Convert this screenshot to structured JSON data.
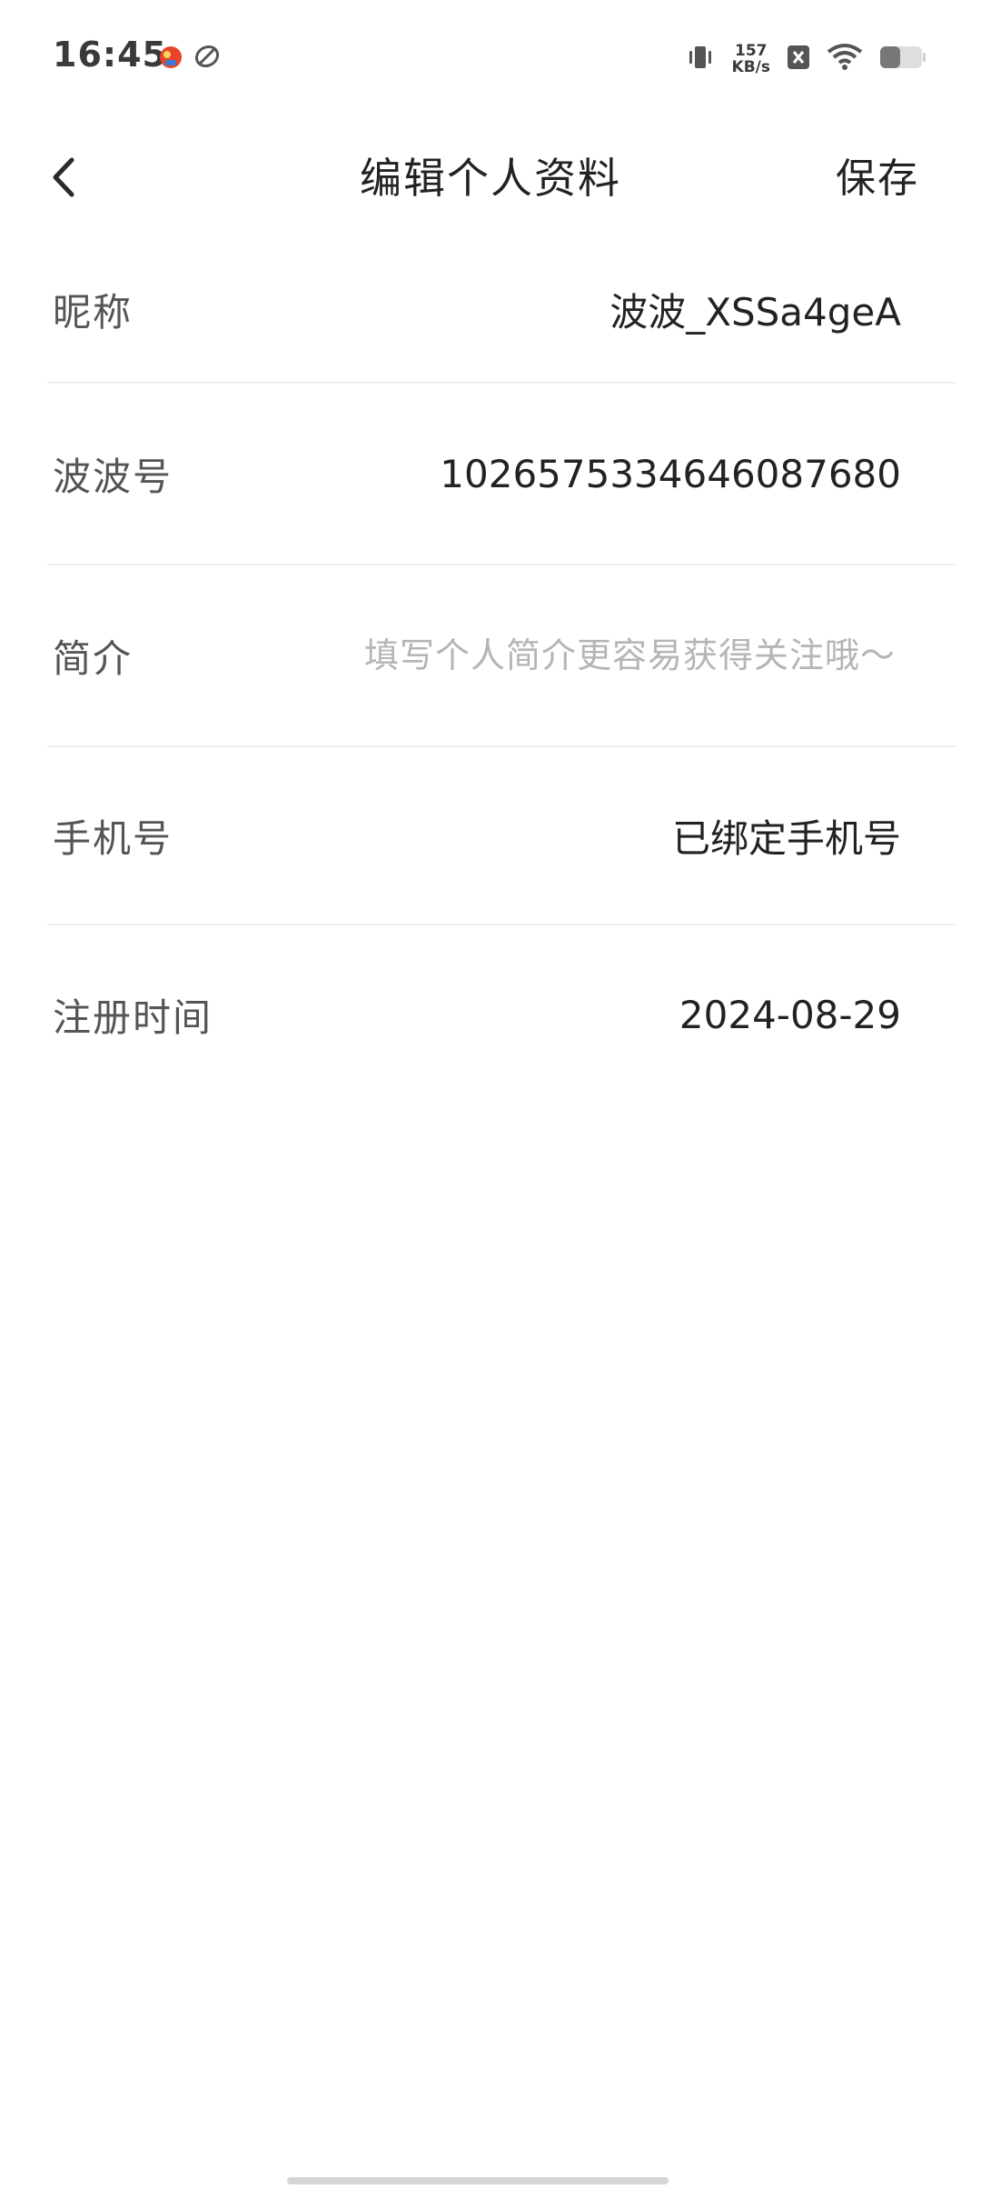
{
  "status_bar": {
    "time": "16:45",
    "net_speed_value": "157",
    "net_speed_unit": "KB/s",
    "icons": [
      "notification-app-icon",
      "sync-app-icon",
      "vibrate-icon",
      "sim-disabled-icon",
      "wifi-icon",
      "battery-icon"
    ]
  },
  "header": {
    "title": "编辑个人资料",
    "save_label": "保存"
  },
  "form": {
    "nickname": {
      "label": "昵称",
      "value": "波波_XSSa4geA"
    },
    "bobo_id": {
      "label": "波波号",
      "value": "1026575334646087680"
    },
    "bio": {
      "label": "简介",
      "value": "",
      "placeholder": "填写个人简介更容易获得关注哦～"
    },
    "phone": {
      "label": "手机号",
      "value": "已绑定手机号"
    },
    "register_time": {
      "label": "注册时间",
      "value": "2024-08-29"
    }
  }
}
